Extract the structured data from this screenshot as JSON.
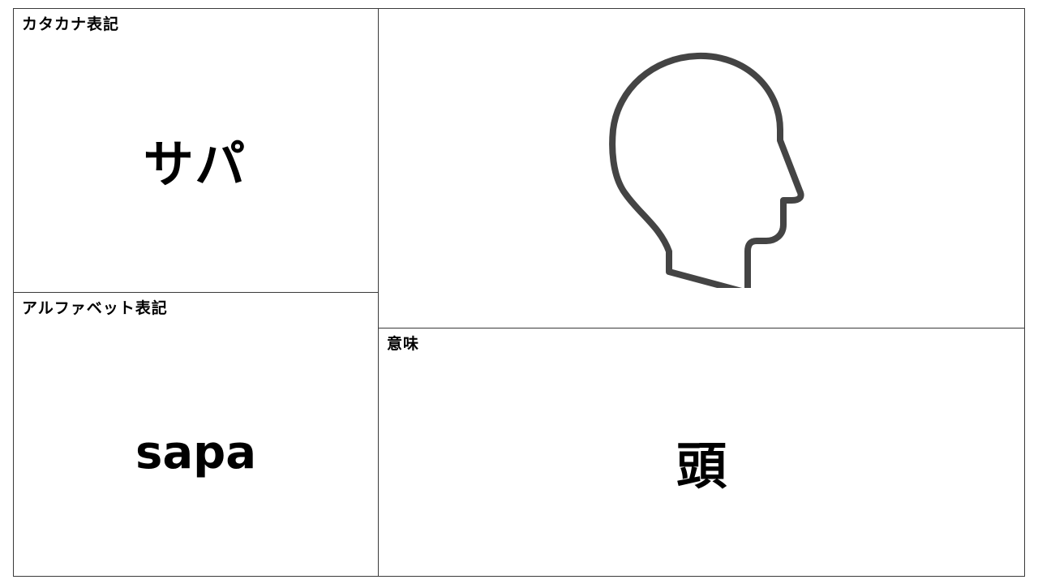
{
  "katakana": {
    "label": "カタカナ表記",
    "value": "サパ"
  },
  "alphabet": {
    "label": "アルファベット表記",
    "value": "sapa"
  },
  "meaning": {
    "label": "意味",
    "value": "頭"
  },
  "illustration": {
    "icon": "head-profile-icon",
    "stroke_color": "#444444"
  }
}
